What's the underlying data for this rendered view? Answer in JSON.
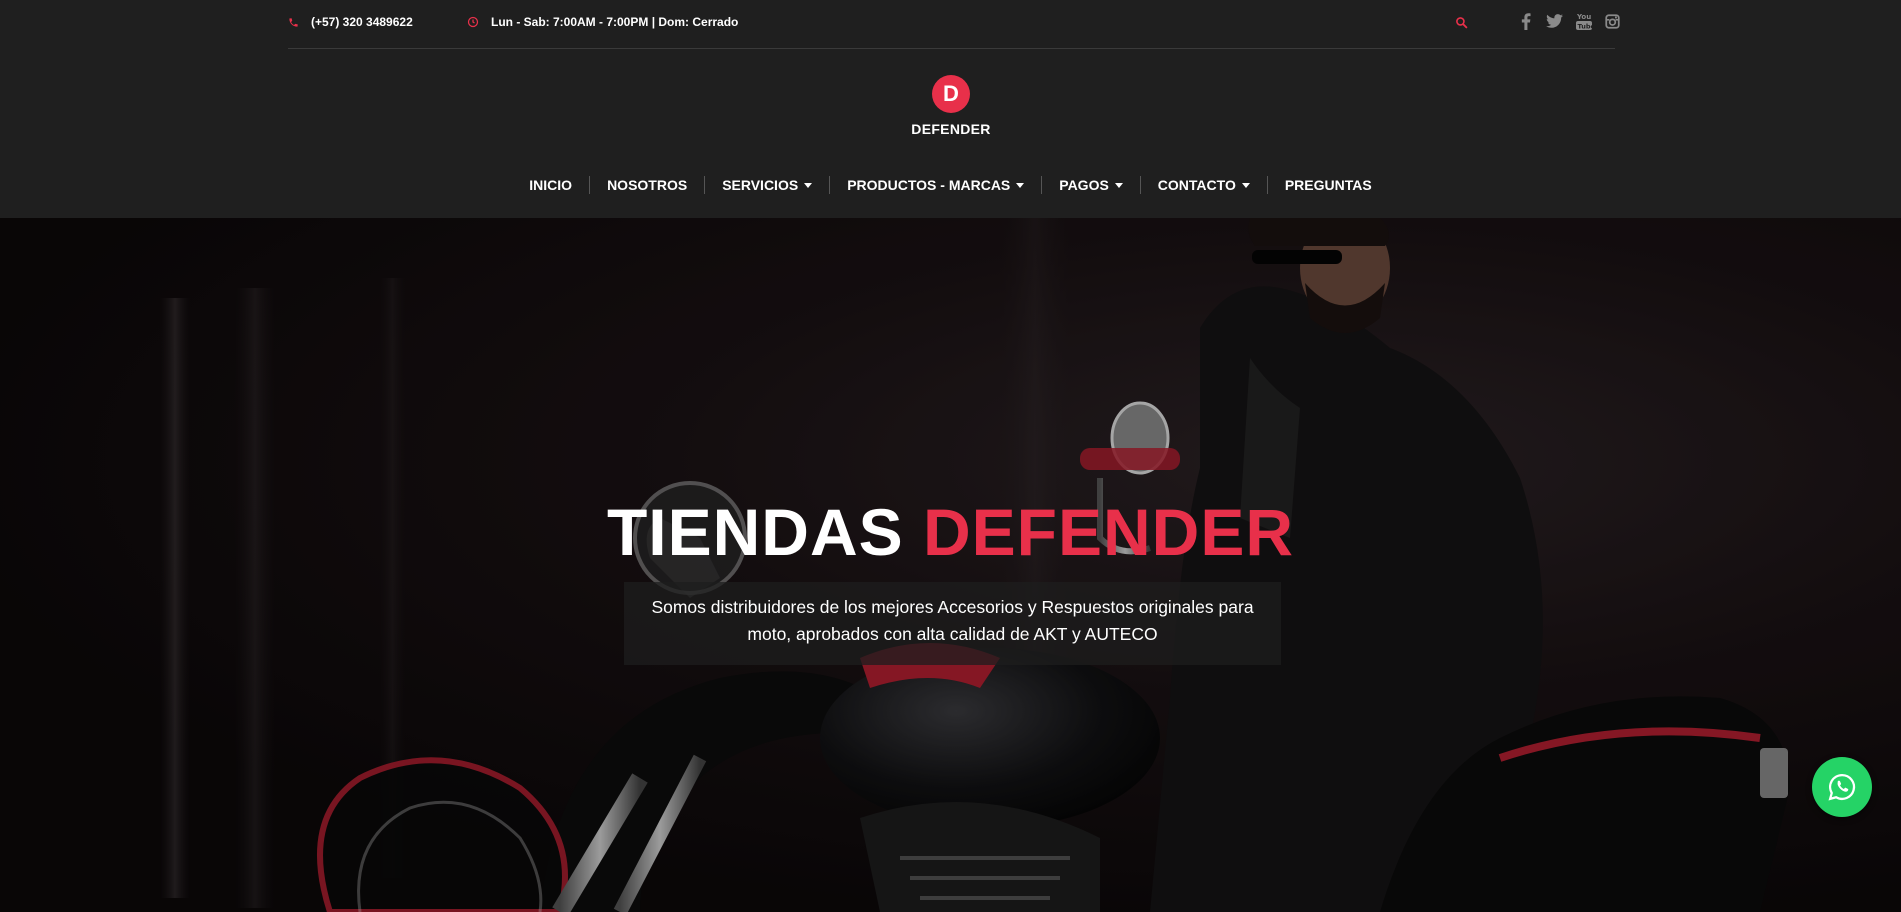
{
  "topbar": {
    "phone": "(+57) 320 3489622",
    "hours": "Lun - Sab: 7:00AM - 7:00PM | Dom: Cerrado",
    "icons": [
      "phone-icon",
      "clock-icon",
      "search-icon",
      "facebook-icon",
      "twitter-icon",
      "youtube-icon",
      "instagram-icon"
    ]
  },
  "brand": {
    "logo_letter": "D",
    "name": "DEFENDER"
  },
  "nav": {
    "items": [
      {
        "label": "INICIO"
      },
      {
        "label": "NOSOTROS"
      },
      {
        "label": "SERVICIOS"
      },
      {
        "label": "PRODUCTOS - MARCAS"
      },
      {
        "label": "PAGOS"
      },
      {
        "label": "CONTACTO"
      },
      {
        "label": "PREGUNTAS"
      }
    ]
  },
  "hero": {
    "title_part1": "TIENDAS",
    "title_part2": "DEFENDER",
    "subtitle": "Somos distribuidores de los mejores Accesorios y Respuestos originales para moto, aprobados con alta calidad de AKT y AUTECO"
  },
  "colors": {
    "accent": "#e8304a",
    "background": "#1f1f1f",
    "whatsapp": "#25d366"
  }
}
